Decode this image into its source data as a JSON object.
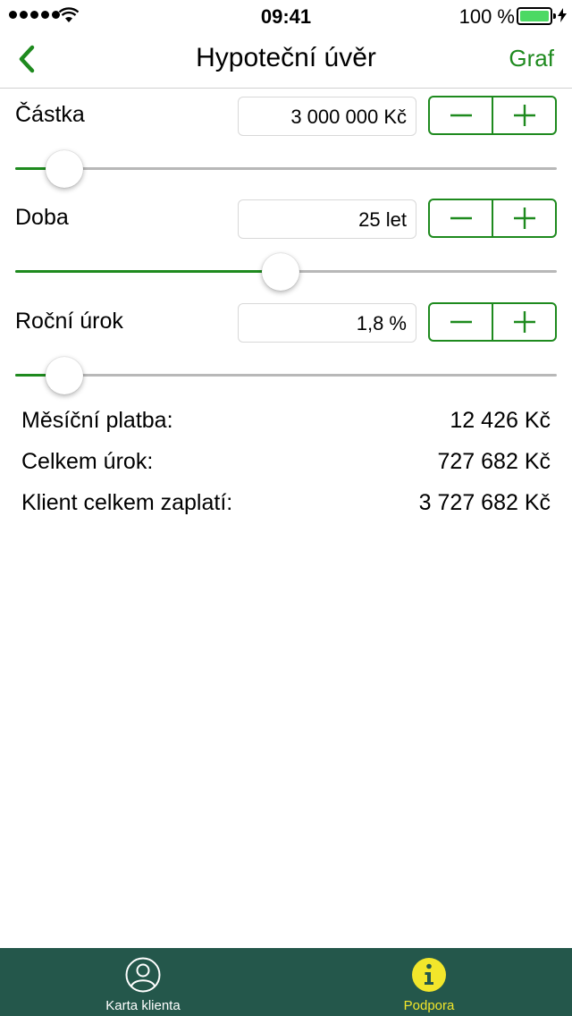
{
  "status_bar": {
    "time": "09:41",
    "battery_text": "100 %",
    "battery_level": 1.0
  },
  "nav": {
    "title": "Hypoteční úvěr",
    "right_action": "Graf",
    "back_icon": "chevron-left-icon"
  },
  "fields": [
    {
      "label": "Částka",
      "value": "3 000 000 Kč",
      "slider_level": 0.09
    },
    {
      "label": "Doba",
      "value": "25 let",
      "slider_level": 0.49
    },
    {
      "label": "Roční úrok",
      "value": "1,8 %",
      "slider_level": 0.09
    }
  ],
  "stepper": {
    "minus_icon": "minus-icon",
    "plus_icon": "plus-icon"
  },
  "results": [
    {
      "label": "Měsíční platba:",
      "value": "12 426 Kč"
    },
    {
      "label": "Celkem úrok:",
      "value": "727 682 Kč"
    },
    {
      "label": "Klient celkem zaplatí:",
      "value": "3 727 682 Kč"
    }
  ],
  "tabbar": {
    "tabs": [
      {
        "label": "Karta klienta",
        "icon": "person-icon",
        "active": false
      },
      {
        "label": "Podpora",
        "icon": "info-icon",
        "active": true
      }
    ]
  },
  "colors": {
    "accent": "#1e8a1e",
    "tabbar_bg": "#24574b",
    "tab_active": "#f2e62b",
    "tab_inactive": "#ffffff"
  }
}
